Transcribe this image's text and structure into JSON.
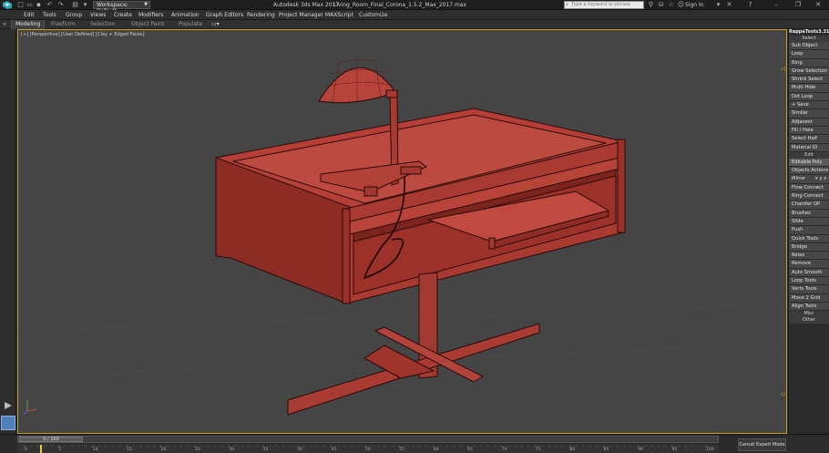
{
  "titlebar": {
    "workspace_label": "Workspace: Default",
    "app_name": "Autodesk 3ds Max 2017",
    "file_name": "Living_Room_Final_Corona_1.5.2_Max_2017.max",
    "search_placeholder": "Type a keyword or phrase",
    "signin_label": "Sign In"
  },
  "menu": [
    "Edit",
    "Tools",
    "Group",
    "Views",
    "Create",
    "Modifiers",
    "Animation",
    "Graph Editors",
    "Rendering",
    "Project Manager",
    "MAXScript",
    "Customize"
  ],
  "ribbon": {
    "tabs": [
      "Modeling",
      "Freeform",
      "Selection",
      "Object Paint",
      "Populate"
    ],
    "active_tab": "Modeling"
  },
  "viewport": {
    "label": "[+] [Perspective] [User Defined] [Clay + Edged Faces]",
    "border_color": "#c9a02a",
    "model_color": "#b34137"
  },
  "tools_panel": {
    "title": "RappaTools3.31",
    "sections": [
      {
        "name": "Select",
        "buttons": [
          "Sub Object",
          "Loop",
          "Ring",
          "Grow Selection",
          "Shrink Select",
          "Multi Hide",
          "Dot Loop",
          "+ Save",
          "Similar",
          "Adjacent",
          "Fill / Hole",
          "Select Half",
          "Material ID"
        ]
      },
      {
        "name": "Edit",
        "buttons": [
          "Editable Poly",
          "Objects Actions",
          "Mirror",
          "Flow Connect",
          "Ring Connect",
          "Chamfer OP",
          "Brushes",
          "Slide",
          "Push",
          "Quick Tools",
          "Bridge",
          "Relax",
          "Remove",
          "Auto Smooth",
          "Loop Tools",
          "Verts Tools",
          "Move 2 Grid",
          "Align Tools"
        ]
      }
    ],
    "mirror_axes": [
      "x",
      "y",
      "z"
    ],
    "footer_sections": [
      "Misc",
      "Other"
    ]
  },
  "timeline": {
    "frame_indicator": "0 / 100",
    "ticks": [
      "0",
      "5",
      "10",
      "15",
      "20",
      "25",
      "30",
      "35",
      "40",
      "45",
      "50",
      "55",
      "60",
      "65",
      "70",
      "75",
      "80",
      "85",
      "90",
      "95",
      "100"
    ],
    "cancel_label": "Cancel Expert Mode"
  }
}
